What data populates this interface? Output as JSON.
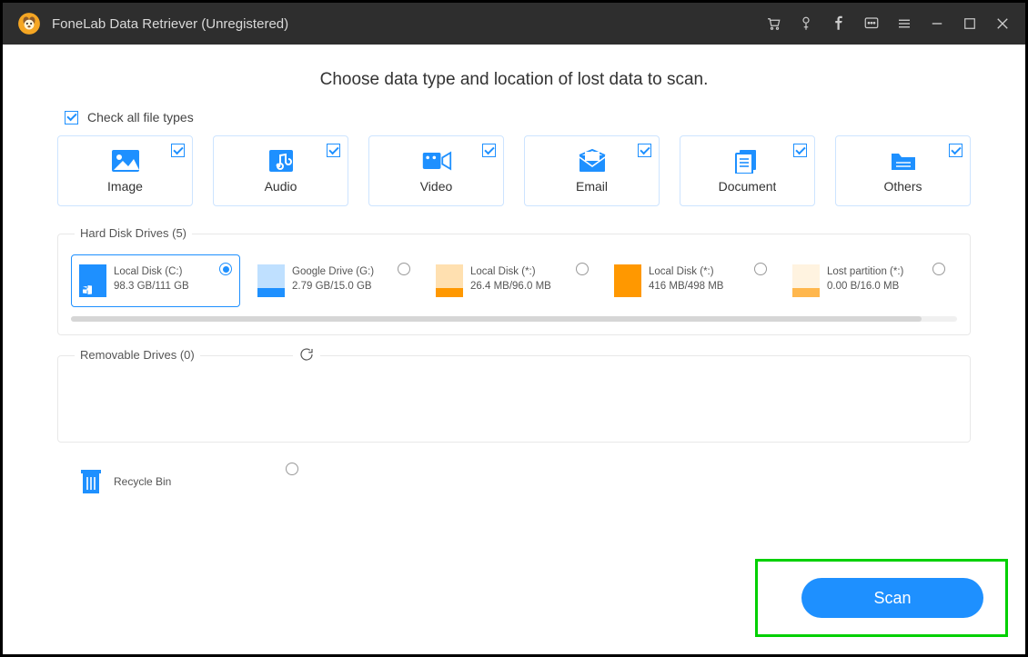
{
  "app": {
    "title": "FoneLab Data Retriever (Unregistered)"
  },
  "heading": "Choose data type and location of lost data to scan.",
  "check_all_label": "Check all file types",
  "types": [
    {
      "label": "Image"
    },
    {
      "label": "Audio"
    },
    {
      "label": "Video"
    },
    {
      "label": "Email"
    },
    {
      "label": "Document"
    },
    {
      "label": "Others"
    }
  ],
  "hdd": {
    "title": "Hard Disk Drives (5)",
    "drives": [
      {
        "name": "Local Disk (C:)",
        "size": "98.3 GB/111 GB"
      },
      {
        "name": "Google Drive (G:)",
        "size": "2.79 GB/15.0 GB"
      },
      {
        "name": "Local Disk (*:)",
        "size": "26.4 MB/96.0 MB"
      },
      {
        "name": "Local Disk (*:)",
        "size": "416 MB/498 MB"
      },
      {
        "name": "Lost partition (*:)",
        "size": "0.00  B/16.0 MB"
      }
    ]
  },
  "removable": {
    "title": "Removable Drives (0)"
  },
  "recycle": {
    "label": "Recycle Bin"
  },
  "scan_label": "Scan"
}
